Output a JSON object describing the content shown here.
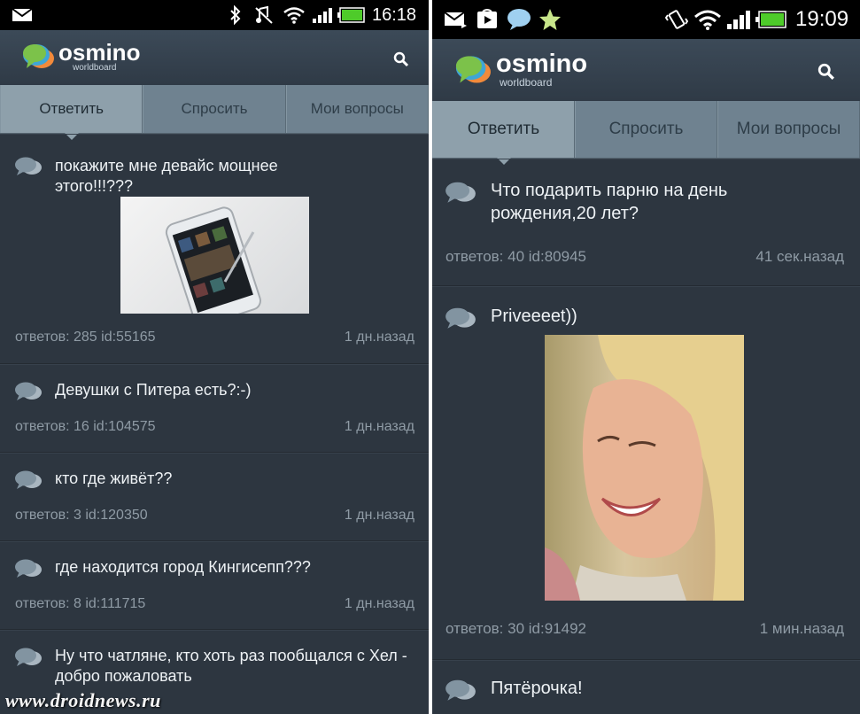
{
  "left": {
    "status": {
      "time": "16:18"
    },
    "logo": {
      "name": "osmino",
      "sub": "worldboard"
    },
    "tabs": [
      {
        "label": "Ответить"
      },
      {
        "label": "Спросить"
      },
      {
        "label": "Мои вопросы"
      }
    ],
    "questions": [
      {
        "title": "покажите мне девайс мощнее этого!!!???",
        "meta": "ответов: 285 id:55165",
        "time": "1 дн.назад"
      },
      {
        "title": "Девушки с Питера есть?:-)",
        "meta": "ответов: 16 id:104575",
        "time": "1 дн.назад"
      },
      {
        "title": "кто где живёт??",
        "meta": "ответов: 3 id:120350",
        "time": "1 дн.назад"
      },
      {
        "title": "где находится город Кингисепп???",
        "meta": "ответов: 8 id:111715",
        "time": "1 дн.назад"
      },
      {
        "title": "Ну что чатляне, кто хоть раз пообщался с Хел - добро пожаловать",
        "meta": "",
        "time": ""
      }
    ],
    "watermark": "www.droidnews.ru"
  },
  "right": {
    "status": {
      "time": "19:09"
    },
    "logo": {
      "name": "osmino",
      "sub": "worldboard"
    },
    "tabs": [
      {
        "label": "Ответить"
      },
      {
        "label": "Спросить"
      },
      {
        "label": "Мои вопросы"
      }
    ],
    "questions": [
      {
        "title": "Что подарить парню на день рождения,20 лет?",
        "meta": "ответов: 40 id:80945",
        "time": "41 сек.назад"
      },
      {
        "title": "Priveeeet))",
        "meta": "ответов: 30 id:91492",
        "time": "1 мин.назад"
      },
      {
        "title": "Пятёрочка!",
        "meta": "",
        "time": ""
      }
    ]
  },
  "colors": {
    "background": "#2d3640",
    "tabs": "#6f8290",
    "tab_active": "#8ea0ab",
    "text": "#eef2f5",
    "meta": "#8f9ba5",
    "logo_bubble_green": "#7cc24a",
    "logo_bubble_blue": "#3fa6d6",
    "logo_bubble_orange": "#f28a3b"
  },
  "icons": [
    "mail-icon",
    "bluetooth-icon",
    "mute-icon",
    "wifi-icon",
    "signal-icon",
    "battery-icon",
    "play-store-icon",
    "chat-bubble-icon",
    "star-icon",
    "vibrate-icon",
    "search-icon",
    "speech-bubble-icon"
  ]
}
